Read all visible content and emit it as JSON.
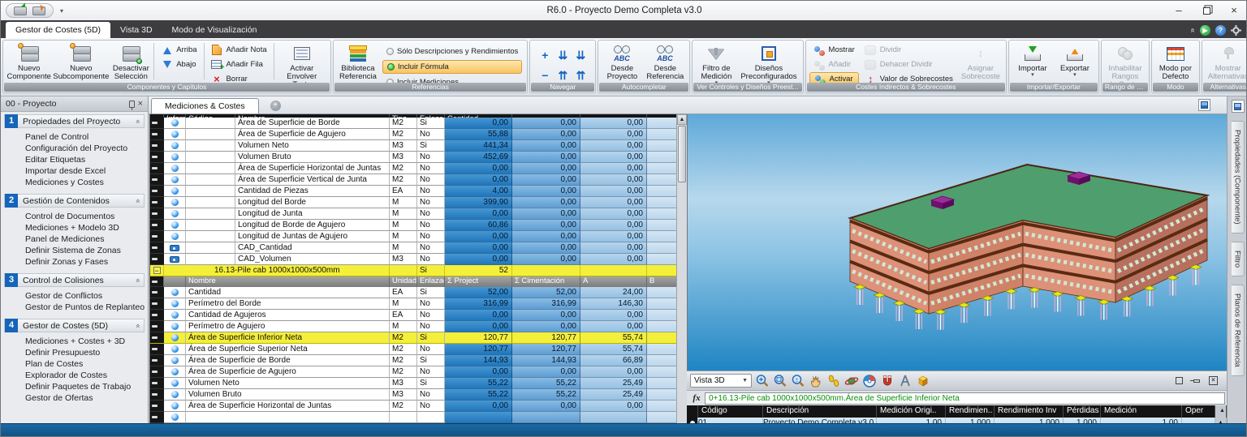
{
  "window": {
    "title": "R6.0 - Proyecto Demo Completa v3.0",
    "controls": [
      "minimize",
      "restore",
      "close"
    ]
  },
  "ribbon": {
    "tabs": [
      {
        "label": "Gestor de Costes (5D)",
        "active": true
      },
      {
        "label": "Vista 3D",
        "active": false
      },
      {
        "label": "Modo de Visualización",
        "active": false
      }
    ],
    "groups": [
      {
        "label": "Componentes y Capítulos",
        "items": [
          {
            "type": "big",
            "label": "Nuevo\nComponente",
            "icon": "brick-new"
          },
          {
            "type": "big",
            "label": "Nuevo\nSubcomponente",
            "icon": "brick-new"
          },
          {
            "type": "big",
            "label": "Desactivar\nSelección",
            "icon": "brick-check"
          },
          {
            "type": "sep"
          },
          {
            "type": "stack",
            "items": [
              {
                "label": "Arriba",
                "icon": "arrow-up-blue"
              },
              {
                "label": "Abajo",
                "icon": "arrow-down-blue"
              }
            ]
          },
          {
            "type": "sep"
          },
          {
            "type": "stack",
            "items": [
              {
                "label": "Añadir Nota",
                "icon": "note"
              },
              {
                "label": "Añadir Fila",
                "icon": "add-row"
              },
              {
                "label": "Borrar",
                "icon": "delete-x"
              }
            ]
          },
          {
            "type": "sep"
          },
          {
            "type": "big",
            "label": "Activar\nEnvolver Texto",
            "icon": "wrap-text"
          }
        ]
      },
      {
        "label": "Referencias",
        "items": [
          {
            "type": "big",
            "label": "Biblioteca\nReferencia",
            "icon": "books"
          },
          {
            "type": "radios",
            "items": [
              {
                "label": "Sólo Descripciones y Rendimientos",
                "selected": false
              },
              {
                "label": "Incluir Fórmula",
                "selected": true
              },
              {
                "label": "Incluir Mediciones",
                "selected": false
              }
            ]
          }
        ]
      },
      {
        "label": "Navegar",
        "items": [
          {
            "type": "navgrid",
            "glyphs": [
              "+",
              "⇊",
              "⇊",
              "−",
              "⇈",
              "⇈"
            ],
            "names": [
              "expand-plus",
              "page-down",
              "jump-down",
              "collapse-minus",
              "page-up",
              "jump-up"
            ]
          }
        ]
      },
      {
        "label": "Autocompletar",
        "items": [
          {
            "type": "big",
            "label": "Desde\nProyecto",
            "icon": "abc-glasses"
          },
          {
            "type": "big",
            "label": "Desde\nReferencia",
            "icon": "abc-glasses"
          }
        ]
      },
      {
        "label": "Ver Controles y Diseños Preest...",
        "items": [
          {
            "type": "big",
            "label": "Filtro de\nMedición",
            "icon": "funnel",
            "arrow": true
          },
          {
            "type": "big",
            "label": "Diseños\nPreconfigurados",
            "icon": "layout-grid",
            "arrow": true
          }
        ]
      },
      {
        "label": "Costes Indirectos & Sobrecostes",
        "items": [
          {
            "type": "stack",
            "items": [
              {
                "label": "Mostrar",
                "icon": "show-costs"
              },
              {
                "label": "Añadir",
                "icon": "add-costs",
                "disabled": true
              },
              {
                "label": "Activar",
                "icon": "activate-costs",
                "highlight": true
              }
            ]
          },
          {
            "type": "stack",
            "items": [
              {
                "label": "Dividir",
                "icon": "split",
                "disabled": true
              },
              {
                "label": "Dehacer Dividir",
                "icon": "unsplit",
                "disabled": true
              },
              {
                "label": "Valor de Sobrecostes",
                "icon": "ibeam"
              }
            ]
          },
          {
            "type": "big",
            "label": "Asignar\nSobrecoste",
            "icon": "assign-cost",
            "disabled": true
          }
        ]
      },
      {
        "label": "Importar/Exportar",
        "items": [
          {
            "type": "big",
            "label": "Importar",
            "icon": "import-tray",
            "arrow": true
          },
          {
            "type": "big",
            "label": "Exportar",
            "icon": "export-tray",
            "arrow": true
          }
        ]
      },
      {
        "label": "Rango de Costes",
        "items": [
          {
            "type": "big",
            "label": "Inhabilitar\nRangos de Costes",
            "icon": "cost-range",
            "disabled": true
          }
        ]
      },
      {
        "label": "Modo",
        "items": [
          {
            "type": "big",
            "label": "Modo por\nDefecto",
            "icon": "grid-mode"
          }
        ]
      },
      {
        "label": "Alternativas",
        "items": [
          {
            "type": "big",
            "label": "Mostrar\nAlternativas",
            "icon": "alternatives",
            "disabled": true
          }
        ]
      }
    ]
  },
  "sidebar": {
    "title": "00 - Proyecto",
    "sections": [
      {
        "num": "1",
        "title": "Propiedades del Proyecto",
        "items": [
          "Panel de Control",
          "Configuración del Proyecto",
          "Editar Etiquetas",
          "Importar desde Excel",
          "Mediciones y Costes"
        ]
      },
      {
        "num": "2",
        "title": "Gestión de Contenidos",
        "items": [
          "Control de Documentos",
          "Mediciones + Modelo 3D",
          "Panel de Mediciones",
          "Definir Sistema de Zonas",
          "Definir Zonas y Fases"
        ]
      },
      {
        "num": "3",
        "title": "Control de Colisiones",
        "items": [
          "Gestor de Conflictos",
          "Gestor de Puntos de Replanteo"
        ]
      },
      {
        "num": "4",
        "title": "Gestor de Costes (5D)",
        "items": [
          "Mediciones + Costes + 3D",
          "Definir Presupuesto",
          "Plan de Costes",
          "Explorador de Costes",
          "Definir Paquetes de Trabajo",
          "Gestor de Ofertas"
        ]
      }
    ]
  },
  "doc_tab": {
    "label": "Mediciones & Costes"
  },
  "main_table": {
    "headers": {
      "inform": "Inform",
      "codigo": "Código",
      "nombre": "Nombre",
      "tipo": "Tipo",
      "enlazado": "Enlazad",
      "cantidad": "Cantidad"
    },
    "top_rows": [
      {
        "name": "Área de Superficie de Borde",
        "tipo": "M2",
        "enl": "Si",
        "v1": "0,00",
        "v2": "0,00",
        "v3": "0,00",
        "partial": true
      },
      {
        "name": "Área de Superficie de Agujero",
        "tipo": "M2",
        "enl": "No",
        "v1": "55,88",
        "v2": "0,00",
        "v3": "0,00"
      },
      {
        "name": "Volumen Neto",
        "tipo": "M3",
        "enl": "Si",
        "v1": "441,34",
        "v2": "0,00",
        "v3": "0,00"
      },
      {
        "name": "Volumen Bruto",
        "tipo": "M3",
        "enl": "No",
        "v1": "452,69",
        "v2": "0,00",
        "v3": "0,00"
      },
      {
        "name": "Área de Superficie Horizontal de Juntas",
        "tipo": "M2",
        "enl": "No",
        "v1": "0,00",
        "v2": "0,00",
        "v3": "0,00"
      },
      {
        "name": "Área de Superficie Vertical de Junta",
        "tipo": "M2",
        "enl": "No",
        "v1": "0,00",
        "v2": "0,00",
        "v3": "0,00"
      },
      {
        "name": "Cantidad de Piezas",
        "tipo": "EA",
        "enl": "No",
        "v1": "4,00",
        "v2": "0,00",
        "v3": "0,00"
      },
      {
        "name": "Longitud del Borde",
        "tipo": "M",
        "enl": "No",
        "v1": "399,90",
        "v2": "0,00",
        "v3": "0,00"
      },
      {
        "name": "Longitud de Junta",
        "tipo": "M",
        "enl": "No",
        "v1": "0,00",
        "v2": "0,00",
        "v3": "0,00"
      },
      {
        "name": "Longitud de Borde de Agujero",
        "tipo": "M",
        "enl": "No",
        "v1": "60,86",
        "v2": "0,00",
        "v3": "0,00"
      },
      {
        "name": "Longitud de Juntas de Agujero",
        "tipo": "M",
        "enl": "No",
        "v1": "0,00",
        "v2": "0,00",
        "v3": "0,00"
      },
      {
        "name": "CAD_Cantidad",
        "tipo": "M",
        "enl": "No",
        "v1": "0,00",
        "v2": "0,00",
        "v3": "0,00",
        "cad": true
      },
      {
        "name": "CAD_Volumen",
        "tipo": "M3",
        "enl": "No",
        "v1": "0,00",
        "v2": "0,00",
        "v3": "0,00",
        "cad": true
      }
    ],
    "group_row": {
      "collapse": "−",
      "label": "16.13-Pile cab 1000x1000x500mm",
      "enl": "Si",
      "cantidad": "52"
    },
    "inner_headers": {
      "nombre": "Nombre",
      "unidad": "Unidad",
      "enlazado": "Enlazad",
      "c1": "Σ Project",
      "c2": "Σ Cimentación",
      "c3": "A",
      "c4": "B"
    },
    "inner_rows": [
      {
        "name": "Cantidad",
        "unidad": "EA",
        "enl": "Si",
        "v1": "52,00",
        "v2": "52,00",
        "v3": "24,00"
      },
      {
        "name": "Perímetro del Borde",
        "unidad": "M",
        "enl": "No",
        "v1": "316,99",
        "v2": "316,99",
        "v3": "146,30"
      },
      {
        "name": "Cantidad de Agujeros",
        "unidad": "EA",
        "enl": "No",
        "v1": "0,00",
        "v2": "0,00",
        "v3": "0,00"
      },
      {
        "name": "Perímetro de Agujero",
        "unidad": "M",
        "enl": "No",
        "v1": "0,00",
        "v2": "0,00",
        "v3": "0,00"
      },
      {
        "name": "Área de Superficie Inferior Neta",
        "unidad": "M2",
        "enl": "Si",
        "v1": "120,77",
        "v2": "120,77",
        "v3": "55,74",
        "selected": true
      },
      {
        "name": "Área de Superficie Superior Neta",
        "unidad": "M2",
        "enl": "No",
        "v1": "120,77",
        "v2": "120,77",
        "v3": "55,74"
      },
      {
        "name": "Área de Superficie de Borde",
        "unidad": "M2",
        "enl": "Si",
        "v1": "144,93",
        "v2": "144,93",
        "v3": "66,89"
      },
      {
        "name": "Área de Superficie de Agujero",
        "unidad": "M2",
        "enl": "No",
        "v1": "0,00",
        "v2": "0,00",
        "v3": "0,00"
      },
      {
        "name": "Volumen Neto",
        "unidad": "M3",
        "enl": "Si",
        "v1": "55,22",
        "v2": "55,22",
        "v3": "25,49"
      },
      {
        "name": "Volumen Bruto",
        "unidad": "M3",
        "enl": "No",
        "v1": "55,22",
        "v2": "55,22",
        "v3": "25,49"
      },
      {
        "name": "Área de Superficie Horizontal de Juntas",
        "unidad": "M2",
        "enl": "No",
        "v1": "0,00",
        "v2": "0,00",
        "v3": "0,00"
      },
      {
        "name": "",
        "unidad": "",
        "enl": "",
        "v1": "",
        "v2": "",
        "v3": "",
        "partial": true
      }
    ]
  },
  "viewport": {
    "view_selector": "Vista 3D",
    "tools": [
      "zoom-dynamic",
      "zoom-window",
      "zoom-extents",
      "pan-hand",
      "walk-mode",
      "orbit-mode",
      "navigation-wheel",
      "magnet-snap",
      "measure-tool",
      "cube-3d"
    ],
    "window_buttons": [
      "maximize",
      "pin",
      "close"
    ]
  },
  "fx": {
    "label": "fx",
    "formula": "0+16.13-Pile cab 1000x1000x500mm.Área de Superficie Inferior Neta"
  },
  "bottom_table": {
    "headers": [
      "Código",
      "Descripción",
      "Medición Origi..",
      "Rendimien..",
      "Rendimiento Inv",
      "Pérdidas",
      "Medición",
      "Oper"
    ],
    "rows": [
      {
        "codigo": "01",
        "descripcion": "Proyecto Demo Completa v3.0",
        "med_orig": "1,00",
        "rend": "1,000",
        "rend_inv": "1,000",
        "perdidas": "1,000",
        "medicion": "1,00"
      }
    ]
  },
  "right_panel": {
    "tabs": [
      "Propiedades (Componente)",
      "Filtro",
      "Planos de Referencia"
    ]
  },
  "colors": {
    "accent_orange": "#f8c561",
    "selection_yellow": "#f4ef39",
    "quantity_column_blue": "#2f86c8",
    "viewport_top_blue": "#5ea9d9",
    "viewport_bottom_blue": "#1f85c3",
    "taskbar_blue": "#15598f",
    "roof_green": "#4f9e6e",
    "wall_salmon": "#dd9178"
  }
}
